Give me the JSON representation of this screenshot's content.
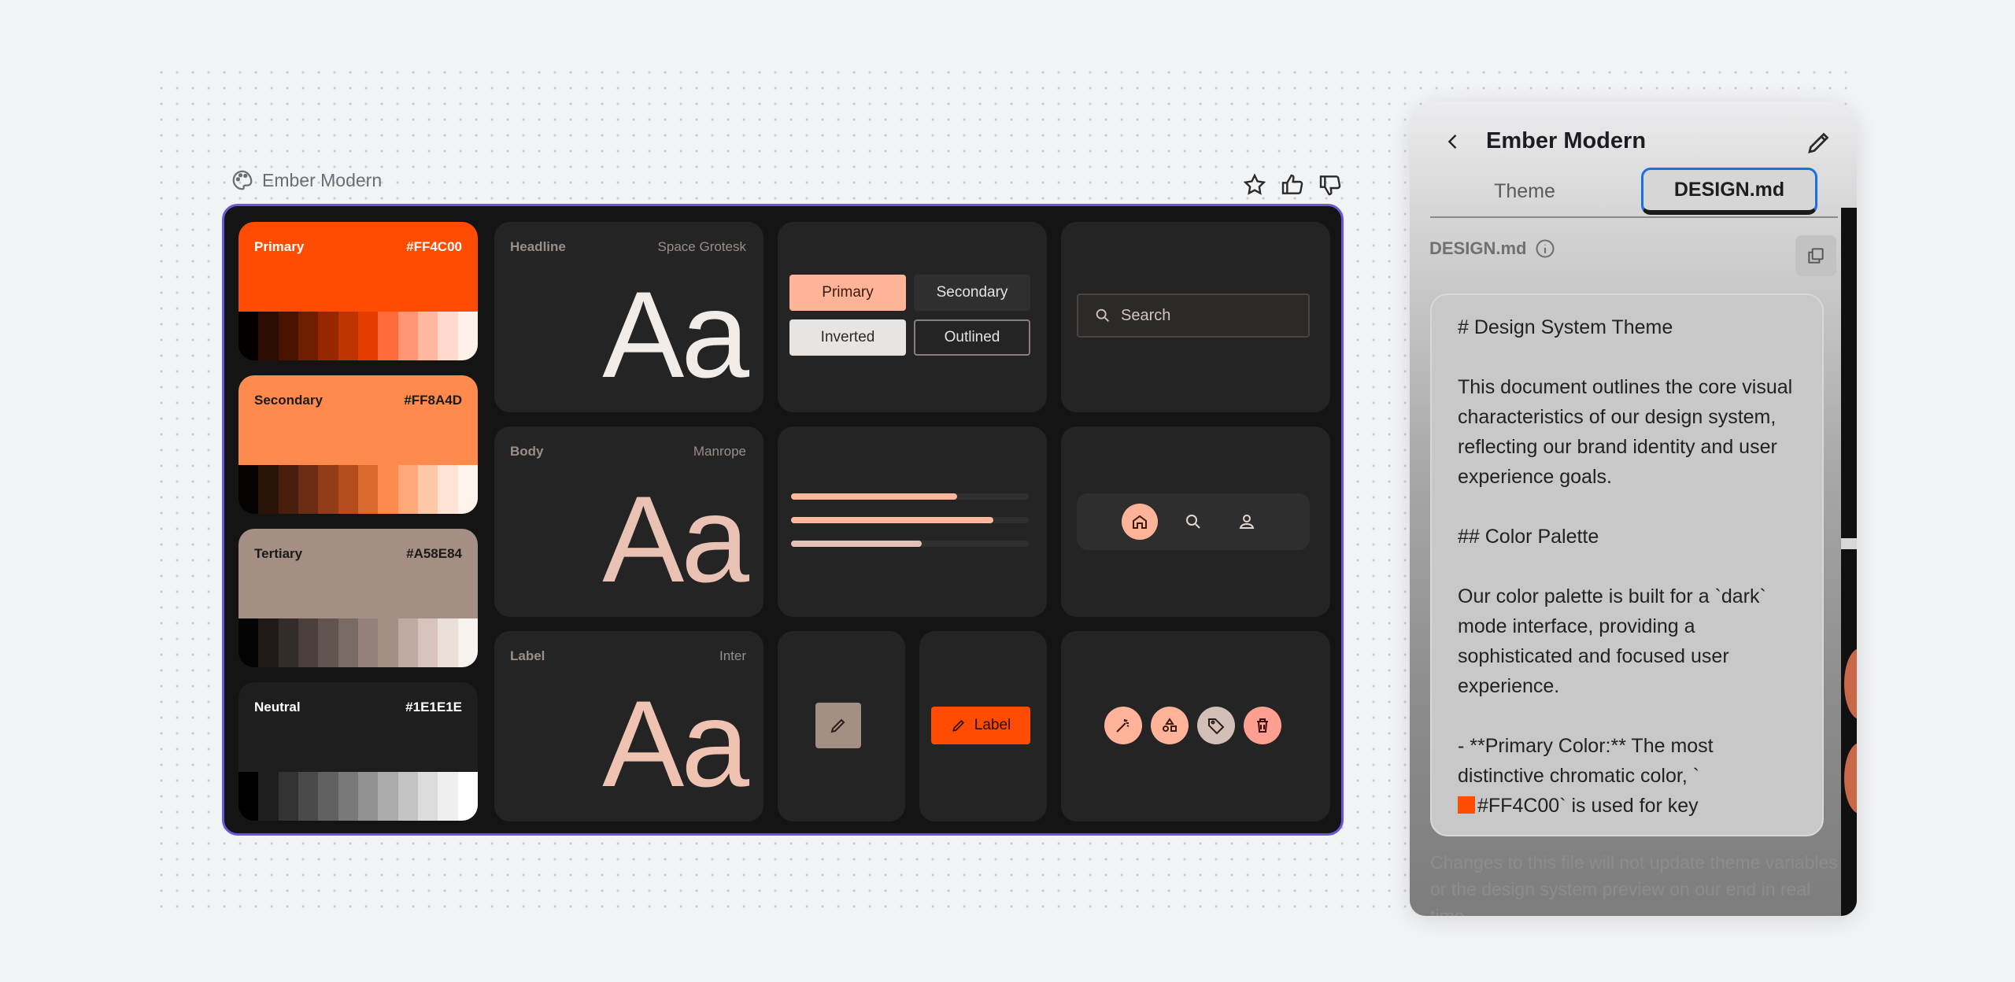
{
  "canvas": {
    "title": "Ember Modern"
  },
  "swatches": [
    {
      "name": "Primary",
      "hex": "#FF4C00",
      "color": "#ff4c00",
      "text_color": "#ffffff",
      "ramp": [
        "#050000",
        "#2a0c00",
        "#4a1300",
        "#6e1d00",
        "#962700",
        "#bf3300",
        "#e63c00",
        "#ff6a38",
        "#ff9575",
        "#ffb8a0",
        "#ffd9cc",
        "#fff0ea"
      ]
    },
    {
      "name": "Secondary",
      "hex": "#FF8A4D",
      "color": "#ff8a4d",
      "text_color": "#1a1a1a",
      "ramp": [
        "#050201",
        "#2a1207",
        "#4a1e0c",
        "#6b2c11",
        "#8f3c17",
        "#b54c1d",
        "#d96a30",
        "#ff8a4d",
        "#ffa97a",
        "#ffc8a8",
        "#ffe3d3",
        "#fff3ec"
      ]
    },
    {
      "name": "Tertiary",
      "hex": "#A58E84",
      "color": "#a58e84",
      "text_color": "#1a1a1a",
      "ramp": [
        "#050404",
        "#1f1a18",
        "#342c29",
        "#4a3f3b",
        "#61544f",
        "#7a6a64",
        "#93817a",
        "#a58e84",
        "#bfa9a0",
        "#d6c4bc",
        "#ebdfda",
        "#f8f2ef"
      ]
    },
    {
      "name": "Neutral",
      "hex": "#1E1E1E",
      "color": "#1e1e1e",
      "text_color": "#ffffff",
      "ramp": [
        "#000000",
        "#1e1e1e",
        "#333333",
        "#4a4a4a",
        "#616161",
        "#797979",
        "#929292",
        "#ababab",
        "#c4c4c4",
        "#dcdcdc",
        "#efefef",
        "#ffffff"
      ]
    }
  ],
  "typography": [
    {
      "role": "Headline",
      "font": "Space Grotesk",
      "sample": "Aa",
      "color": "#f2ece9"
    },
    {
      "role": "Body",
      "font": "Manrope",
      "sample": "Aa",
      "color": "#e9c2b4"
    },
    {
      "role": "Label",
      "font": "Inter",
      "sample": "Aa",
      "color": "#efc2b1"
    }
  ],
  "buttons": {
    "primary": "Primary",
    "secondary": "Secondary",
    "inverted": "Inverted",
    "outlined": "Outlined",
    "label": "Label"
  },
  "search": {
    "placeholder": "Search"
  },
  "progress": [
    {
      "value": 0.7,
      "color": "#ffb89c"
    },
    {
      "value": 0.85,
      "color": "#ffb89c"
    },
    {
      "value": 0.55,
      "color": "#e3c2b5"
    }
  ],
  "colors": {
    "accent": "#ff4c00",
    "accent_light": "#ffb49a",
    "tertiary_light": "#d2c0b8",
    "chip_pink": "#ff9f91",
    "selection_border": "#6a58d8",
    "tab_focus": "#1a6ee8"
  },
  "nav_icons": [
    "home-icon",
    "search-icon",
    "person-icon"
  ],
  "action_icons": [
    "magic-wand-icon",
    "shapes-icon",
    "tag-icon",
    "delete-icon"
  ],
  "panel": {
    "title": "Ember Modern",
    "tabs": [
      "Theme",
      "DESIGN.md"
    ],
    "active_tab": "DESIGN.md",
    "file_label": "DESIGN.md",
    "doc_lines": {
      "h1": "# Design System Theme",
      "p1": "This document outlines the core visual characteristics of our design system, reflecting our brand identity and user experience goals.",
      "h2": "## Color Palette",
      "p2": "Our color palette is built for a `dark` mode interface, providing a sophisticated and focused user experience.",
      "li1a": "-   **Primary Color:** The most distinctive chromatic color, `",
      "li1b": "#FF4C00`  is used for key"
    },
    "footnote": "Changes to this file will not update theme variables or the design system preview on our end in real time."
  }
}
